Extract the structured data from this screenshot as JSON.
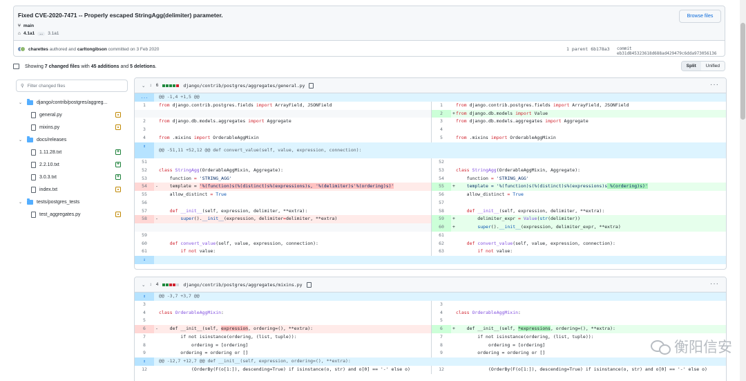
{
  "commit": {
    "title": "Fixed CVE-2020-7471 -- Properly escaped StringAgg(delimiter) parameter.",
    "browse_files": "Browse files",
    "branch": "main",
    "tag_first": "4.1a1",
    "tag_ellipsis": "...",
    "tag_last": "3.1a1",
    "author": "charettes",
    "authored_text": "authored and",
    "committer": "carltongibson",
    "committed_text": "committed on 3 Feb 2020",
    "parent": "1 parent 6b178a3",
    "hash": "commit eb31d845323618d688ad429479c6dda973056136"
  },
  "summary": {
    "text_a": "Showing ",
    "changed": "7 changed files",
    "text_b": " with ",
    "additions": "45 additions",
    "text_c": " and ",
    "deletions": "5 deletions",
    "text_d": ".",
    "split_label": "Split",
    "unified_label": "Unified"
  },
  "tree": {
    "filter_placeholder": "Filter changed files",
    "items": [
      {
        "label": "django/contrib/postgres/aggreg...",
        "type": "folder"
      },
      {
        "label": "general.py",
        "type": "file",
        "status": "modified"
      },
      {
        "label": "mixins.py",
        "type": "file",
        "status": "modified"
      },
      {
        "label": "docs/releases",
        "type": "folder"
      },
      {
        "label": "1.11.28.txt",
        "type": "file",
        "status": "added"
      },
      {
        "label": "2.2.10.txt",
        "type": "file",
        "status": "added"
      },
      {
        "label": "3.0.3.txt",
        "type": "file",
        "status": "added"
      },
      {
        "label": "index.txt",
        "type": "file",
        "status": "modified"
      },
      {
        "label": "tests/postgres_tests",
        "type": "folder"
      },
      {
        "label": "test_aggregates.py",
        "type": "file",
        "status": "modified"
      }
    ]
  },
  "diff1": {
    "count": "6",
    "path": "django/contrib/postgres/aggregates/general.py",
    "more": "···",
    "expand_dots": "...",
    "hunk1": "@@ -1,4 +1,5 @@",
    "hunk2": "@@ -51,11 +52,12 @@ def convert_value(self, value, expression, connection):",
    "l1": "1",
    "c1": "from django.contrib.postgres.fields import ArrayField, JSONField",
    "r1": "1",
    "r2": "2",
    "cr2": "from django.db.models import Value",
    "l2": "2",
    "c2": "from django.db.models.aggregates import Aggregate",
    "r3": "3",
    "l3": "3",
    "r4": "4",
    "l4": "4",
    "c4": "from .mixins import OrderableAggMixin",
    "r5": "5",
    "l51": "51",
    "r52": "52",
    "l52": "52",
    "c52": "class StringAgg(OrderableAggMixin, Aggregate):",
    "r53": "53",
    "l53": "53",
    "c53": "    function = 'STRING_AGG'",
    "r54": "54",
    "l54": "54",
    "c54a": "    template = ",
    "c54b": "'%(function)s(%(distinct)s%(expressions)s,",
    "c54c": " '%(delimiter)s'%(ordering)s)'",
    "r55": "55",
    "cr55a": "    template = '%(function)s(%(distinct)s%(expressions)s",
    "cr55b": " %(ordering)s)'",
    "l55": "55",
    "c55": "    allow_distinct = True",
    "r56": "56",
    "l56": "56",
    "r57": "57",
    "l57": "57",
    "c57": "    def __init__(self, expression, delimiter, **extra):",
    "r58": "58",
    "l58": "58",
    "c58": "        super().__init__(expression, delimiter=delimiter, **extra)",
    "r59": "59",
    "cr59": "        delimiter_expr = Value(str(delimiter))",
    "r60": "60",
    "cr60": "        super().__init__(expression, delimiter_expr, **extra)",
    "l59": "59",
    "r61": "61",
    "l60": "60",
    "c60": "    def convert_value(self, value, expression, connection):",
    "r62": "62",
    "l61": "61",
    "c61": "        if not value:",
    "r63": "63",
    "sign_minus": "-",
    "sign_plus": "+"
  },
  "diff2": {
    "count": "4",
    "path": "django/contrib/postgres/aggregates/mixins.py",
    "more": "···",
    "hunk1": "@@ -3,7 +3,7 @@",
    "hunk2": "@@ -12,7 +12,7 @@ def __init__(self, expression, ordering=(), **extra):",
    "l3": "3",
    "r3": "3",
    "l4": "4",
    "c4": "class OrderableAggMixin:",
    "r4": "4",
    "l5": "5",
    "r5": "5",
    "l6": "6",
    "c6a": "    def __init__(self, ",
    "c6b": "expression",
    "c6c": ", ordering=(), **extra):",
    "r6": "6",
    "cr6a": "    def __init__(self, ",
    "cr6b": "*expressions",
    "cr6c": ", ordering=(), **extra):",
    "l7": "7",
    "c7": "        if not isinstance(ordering, (list, tuple)):",
    "r7": "7",
    "l8": "8",
    "c8": "            ordering = [ordering]",
    "r8": "8",
    "l9": "9",
    "c9": "        ordering = ordering or []",
    "r9": "9",
    "l12": "12",
    "c12": "            (OrderBy(F(o[1:]), descending=True) if isinstance(o, str) and o[0] == '-' else o)",
    "r12": "12",
    "sign_minus": "-",
    "sign_plus": "+"
  },
  "watermark": "衡阳信安"
}
